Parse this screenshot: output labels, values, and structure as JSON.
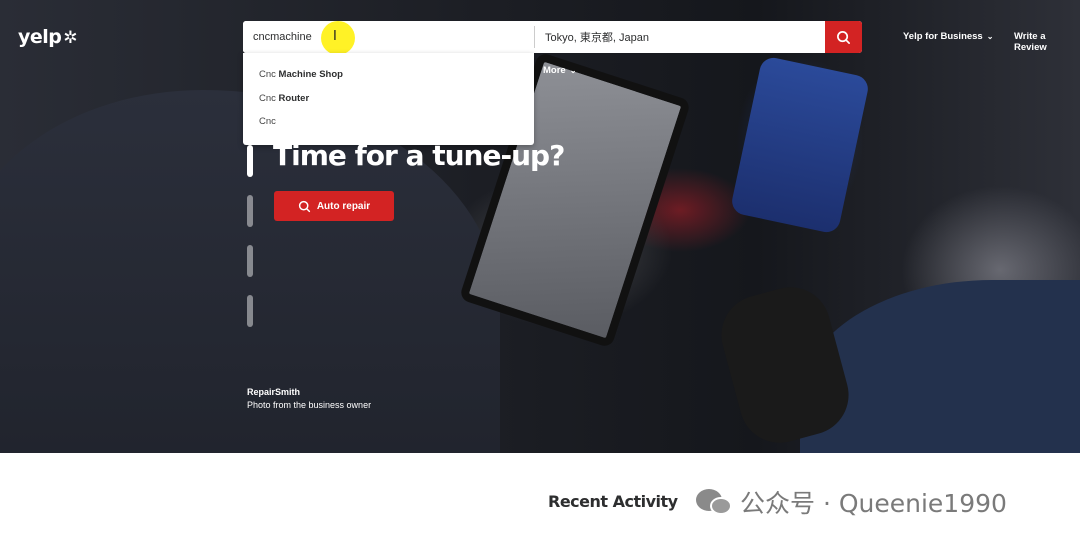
{
  "brand": {
    "logo_text": "yelp",
    "logo_burst": "✲"
  },
  "search": {
    "find_value": "cncmachine",
    "near_value": "Tokyo, 東京都, Japan",
    "suggestions": [
      {
        "prefix": "Cnc",
        "rest": " Machine Shop"
      },
      {
        "prefix": "Cnc",
        "rest": " Router"
      },
      {
        "prefix": "Cnc",
        "rest": ""
      }
    ]
  },
  "nav": {
    "yelp_for_business": "Yelp for Business",
    "write_review": "Write a Review",
    "more": "More",
    "chevron": "⌄"
  },
  "hero": {
    "headline": "Time for a tune-up?",
    "cta_label": "Auto repair",
    "credit_business": "RepairSmith",
    "credit_note": "Photo from the business owner",
    "slide_count": 4,
    "active_slide": 1
  },
  "sections": {
    "recent_activity": "Recent Activity"
  },
  "watermark": {
    "text": "公众号 · Queenie1990"
  },
  "colors": {
    "brand_red": "#d32323",
    "highlight_yellow": "#fff000"
  },
  "icons": {
    "search": "search-icon",
    "chevron_down": "chevron-down-icon",
    "text_cursor": "text-cursor-icon",
    "wechat": "wechat-icon"
  }
}
